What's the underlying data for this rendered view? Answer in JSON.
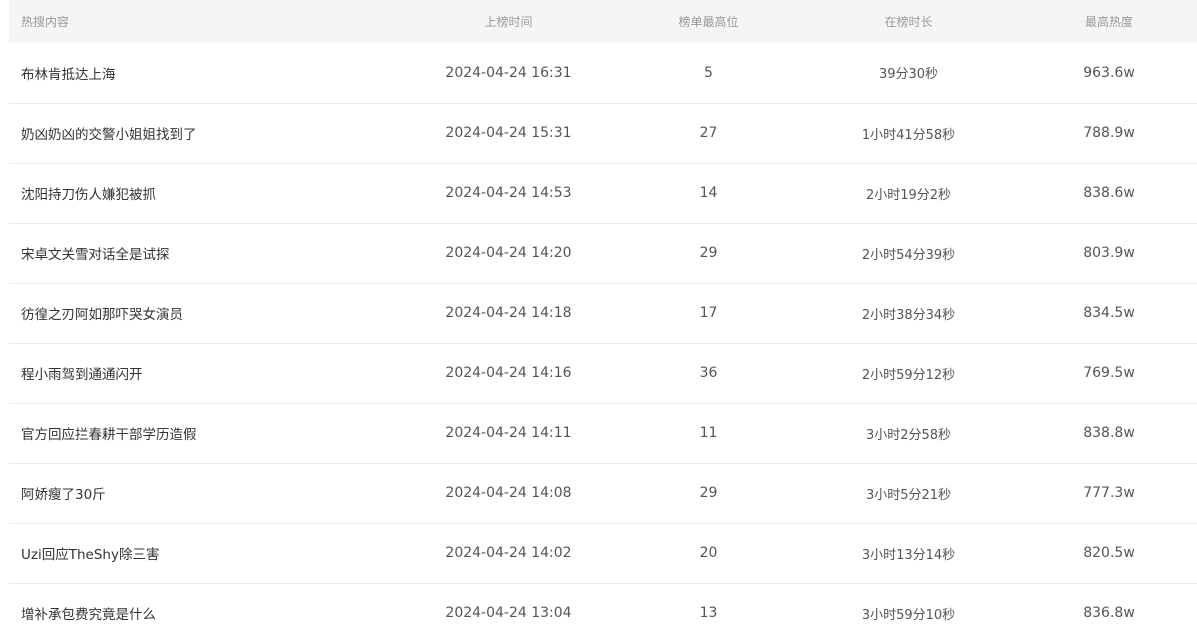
{
  "table": {
    "headers": {
      "content": "热搜内容",
      "time": "上榜时间",
      "rank": "榜单最高位",
      "duration": "在榜时长",
      "heat": "最高热度"
    },
    "rows": [
      {
        "content": "布林肯抵达上海",
        "time": "2024-04-24 16:31",
        "rank": "5",
        "duration": "39分30秒",
        "heat": "963.6w"
      },
      {
        "content": "奶凶奶凶的交警小姐姐找到了",
        "time": "2024-04-24 15:31",
        "rank": "27",
        "duration": "1小时41分58秒",
        "heat": "788.9w"
      },
      {
        "content": "沈阳持刀伤人嫌犯被抓",
        "time": "2024-04-24 14:53",
        "rank": "14",
        "duration": "2小时19分2秒",
        "heat": "838.6w"
      },
      {
        "content": "宋卓文关雪对话全是试探",
        "time": "2024-04-24 14:20",
        "rank": "29",
        "duration": "2小时54分39秒",
        "heat": "803.9w"
      },
      {
        "content": "彷徨之刃阿如那吓哭女演员",
        "time": "2024-04-24 14:18",
        "rank": "17",
        "duration": "2小时38分34秒",
        "heat": "834.5w"
      },
      {
        "content": "程小雨驾到通通闪开",
        "time": "2024-04-24 14:16",
        "rank": "36",
        "duration": "2小时59分12秒",
        "heat": "769.5w"
      },
      {
        "content": "官方回应拦春耕干部学历造假",
        "time": "2024-04-24 14:11",
        "rank": "11",
        "duration": "3小时2分58秒",
        "heat": "838.8w"
      },
      {
        "content": "阿娇瘦了30斤",
        "time": "2024-04-24 14:08",
        "rank": "29",
        "duration": "3小时5分21秒",
        "heat": "777.3w"
      },
      {
        "content": "Uzi回应TheShy除三害",
        "time": "2024-04-24 14:02",
        "rank": "20",
        "duration": "3小时13分14秒",
        "heat": "820.5w"
      },
      {
        "content": "增补承包费究竟是什么",
        "time": "2024-04-24 13:04",
        "rank": "13",
        "duration": "3小时59分10秒",
        "heat": "836.8w"
      }
    ]
  }
}
